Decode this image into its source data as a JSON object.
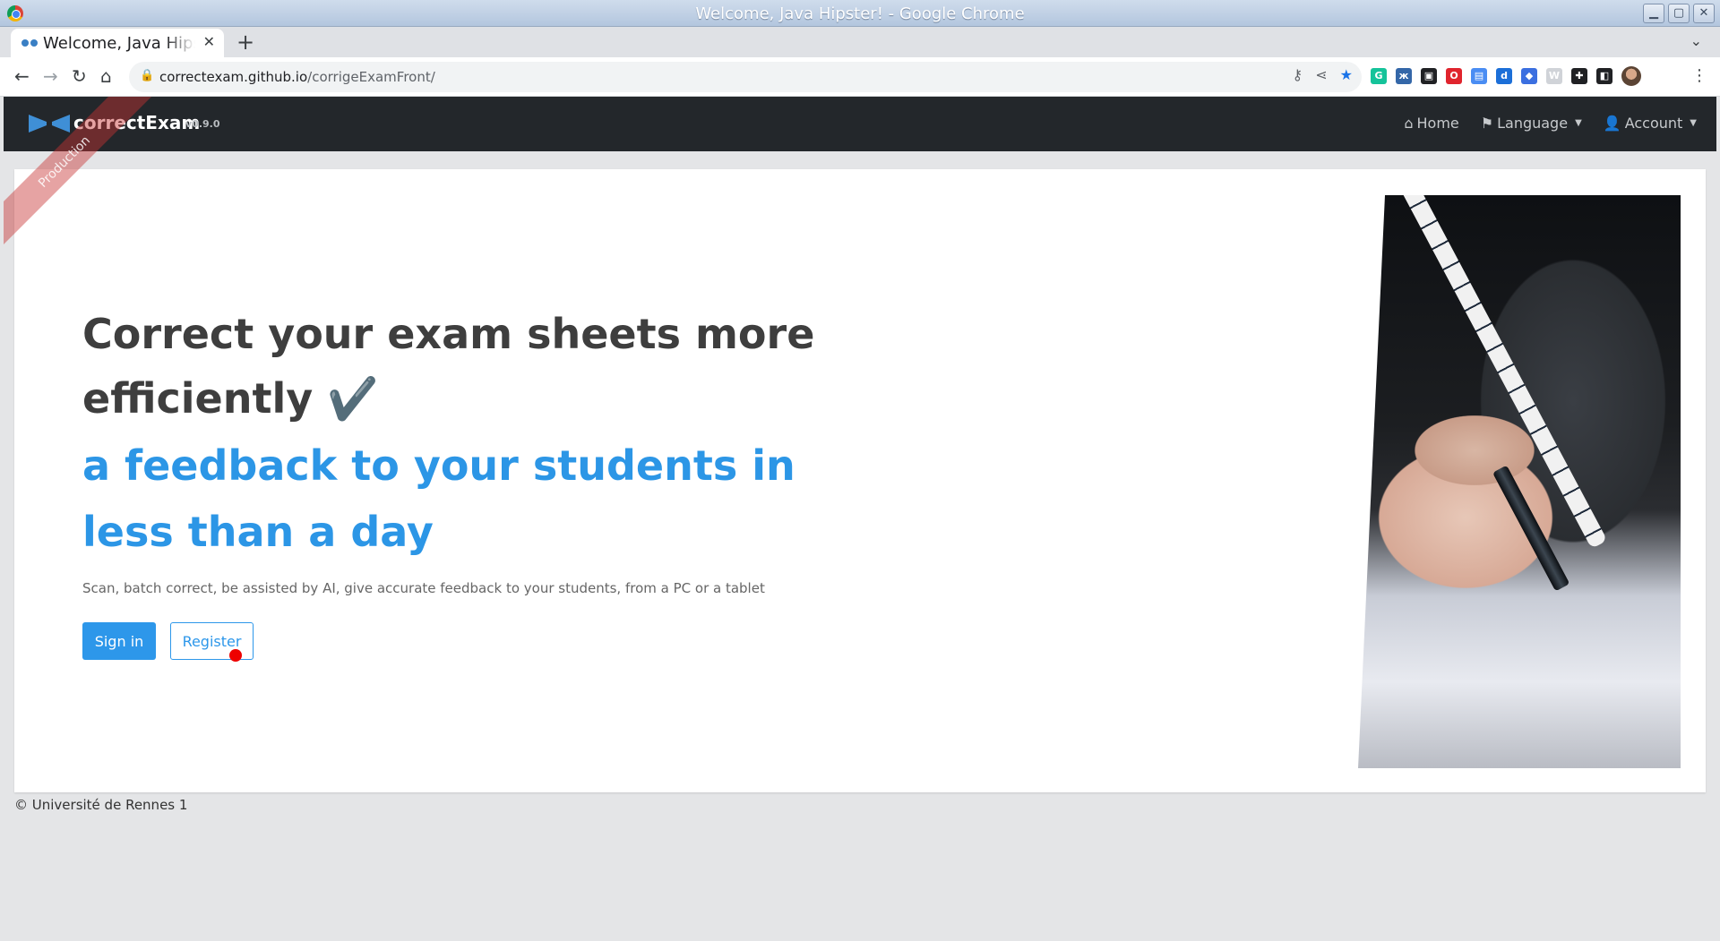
{
  "window": {
    "title": "Welcome, Java Hipster! - Google Chrome",
    "buttons": {
      "minimize": "▁",
      "maximize": "▢",
      "close": "✕"
    }
  },
  "browser": {
    "tab_title": "Welcome, Java Hipster!",
    "tab_close": "✕",
    "new_tab": "+",
    "tab_menu": "⌄",
    "nav": {
      "back": "←",
      "forward": "→",
      "reload": "↻",
      "home": "⌂"
    },
    "url_host": "correctexam.github.io",
    "url_path": "/corrigeExamFront/",
    "omnibox_icons": {
      "key": "⚷",
      "share": "⋖",
      "bookmark": "★"
    },
    "menu": "⋮",
    "extensions": [
      {
        "name": "grammarly-icon",
        "color": "#15c39a",
        "glyph": "G"
      },
      {
        "name": "translate-icon",
        "color": "#3467a8",
        "glyph": "ж"
      },
      {
        "name": "incognito-ext-icon",
        "color": "#202124",
        "glyph": "▣"
      },
      {
        "name": "opera-icon",
        "color": "#e0242d",
        "glyph": "O"
      },
      {
        "name": "docs-icon",
        "color": "#4a8df3",
        "glyph": "▤"
      },
      {
        "name": "dict-icon",
        "color": "#1c6fd8",
        "glyph": "d"
      },
      {
        "name": "layers-icon",
        "color": "#3b6fe0",
        "glyph": "◆"
      },
      {
        "name": "word-icon",
        "color": "#d0d3d8",
        "glyph": "W"
      },
      {
        "name": "puzzle-icon",
        "color": "#202124",
        "glyph": "✚"
      },
      {
        "name": "sidepanel-icon",
        "color": "#202124",
        "glyph": "◧"
      }
    ]
  },
  "app": {
    "brand": "correctExam",
    "version": "v0.9.0",
    "ribbon": "Production",
    "nav": {
      "home": "Home",
      "language": "Language",
      "account": "Account"
    },
    "hero": {
      "title": "Correct your exam sheets more efficiently",
      "title_emoji": "✔️",
      "subtitle": "a feedback to your students in less than a day",
      "description": "Scan, batch correct, be assisted by AI, give accurate feedback to your students, from a PC or a tablet",
      "signin": "Sign in",
      "register": "Register"
    },
    "footer": "© Université de Rennes 1"
  }
}
